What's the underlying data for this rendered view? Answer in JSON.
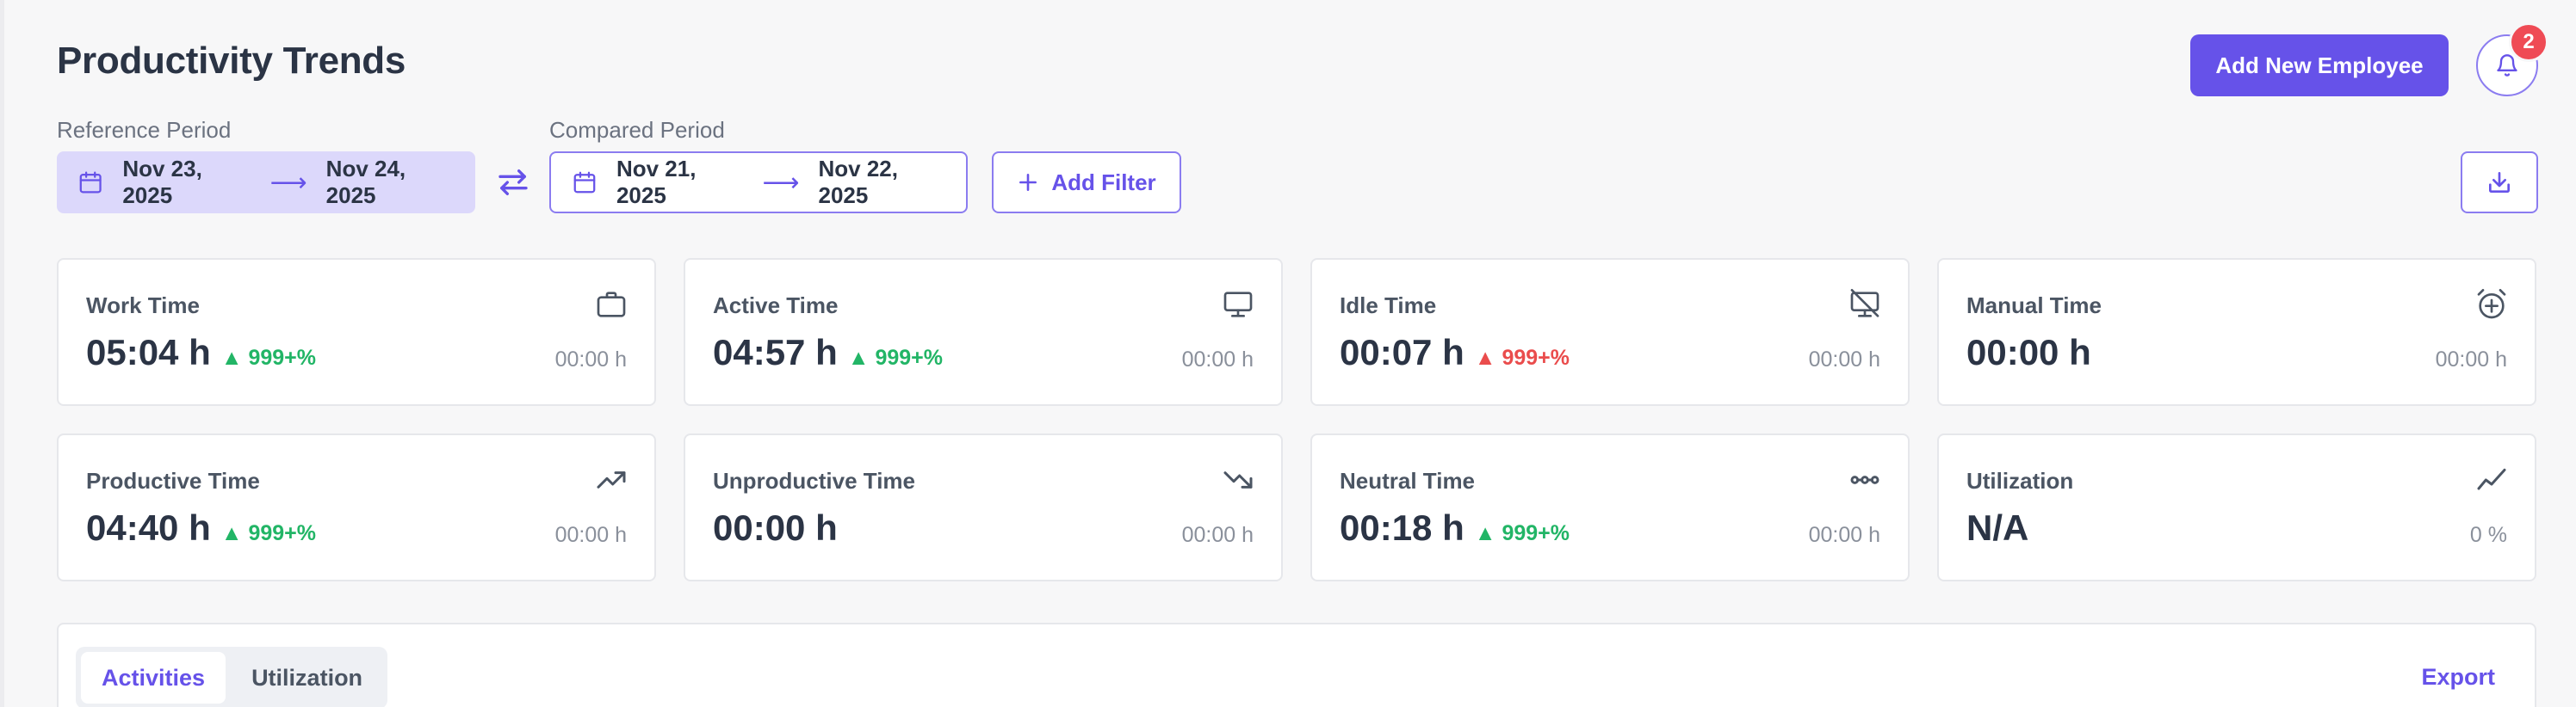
{
  "header": {
    "title": "Productivity Trends",
    "add_employee_label": "Add New Employee",
    "notification_count": "2"
  },
  "periods": {
    "reference": {
      "label": "Reference Period",
      "start": "Nov 23, 2025",
      "end": "Nov 24, 2025"
    },
    "compared": {
      "label": "Compared Period",
      "start": "Nov 21, 2025",
      "end": "Nov 22, 2025"
    },
    "add_filter_label": "Add Filter"
  },
  "metrics": [
    {
      "label": "Work Time",
      "value": "05:04 h",
      "delta": "999+%",
      "trend": "up",
      "compare": "00:00 h",
      "icon": "briefcase-icon"
    },
    {
      "label": "Active Time",
      "value": "04:57 h",
      "delta": "999+%",
      "trend": "up",
      "compare": "00:00 h",
      "icon": "monitor-icon"
    },
    {
      "label": "Idle Time",
      "value": "00:07 h",
      "delta": "999+%",
      "trend": "down",
      "compare": "00:00 h",
      "icon": "monitor-off-icon"
    },
    {
      "label": "Manual Time",
      "value": "00:00 h",
      "delta": "",
      "trend": "none",
      "compare": "00:00 h",
      "icon": "alarm-plus-icon"
    },
    {
      "label": "Productive Time",
      "value": "04:40 h",
      "delta": "999+%",
      "trend": "up",
      "compare": "00:00 h",
      "icon": "trending-up-icon"
    },
    {
      "label": "Unproductive Time",
      "value": "00:00 h",
      "delta": "",
      "trend": "none",
      "compare": "00:00 h",
      "icon": "trending-down-icon"
    },
    {
      "label": "Neutral Time",
      "value": "00:18 h",
      "delta": "999+%",
      "trend": "up",
      "compare": "00:00 h",
      "icon": "dots-horizontal-icon"
    },
    {
      "label": "Utilization",
      "value": "N/A",
      "delta": "",
      "trend": "none",
      "compare": "0 %",
      "icon": "chart-line-icon"
    }
  ],
  "tabs": [
    {
      "label": "Activities",
      "active": true
    },
    {
      "label": "Utilization",
      "active": false
    }
  ],
  "export_label": "Export",
  "colors": {
    "accent": "#6652e9",
    "positive": "#22b566",
    "negative": "#ea4c4c",
    "badge": "#ef4b55"
  }
}
